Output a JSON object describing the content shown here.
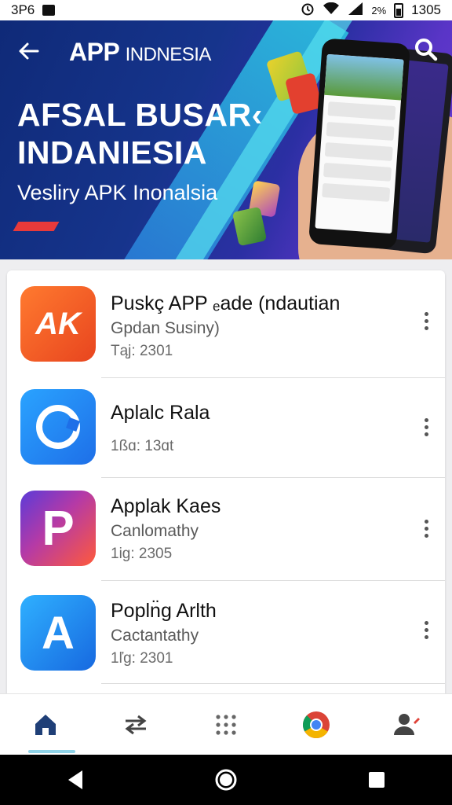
{
  "status_bar": {
    "left_text": "3P6",
    "time": "1305",
    "battery_text": "2%",
    "icons": [
      "notification-icon",
      "alarm-icon",
      "wifi-icon",
      "signal-icon",
      "battery-icon"
    ]
  },
  "header": {
    "brand_part1": "APP",
    "brand_part2": "INDNESIA",
    "back_icon": "back-arrow-icon",
    "search_icon": "search-icon"
  },
  "banner": {
    "title_line1": "AFSAL BUSAR‹",
    "title_line2": "INDANIESIA",
    "subtitle": "Vesliry APK Inonalsia",
    "accent_color": "#e83a3a"
  },
  "apps": [
    {
      "name": "Puskç APP ₑade (ndautian",
      "subtitle": "Gpdan Susiny)",
      "meta": "Tąj: 2301",
      "icon_label": "AK",
      "icon": "ak-app-icon"
    },
    {
      "name": "Aplalc Rala",
      "subtitle": "",
      "meta": "1ßɑ: 13ɑt",
      "icon_label": "",
      "icon": "c-ring-app-icon"
    },
    {
      "name": "Applak Kaes",
      "subtitle": "Canlomathy",
      "meta": "1ig: 2305",
      "icon_label": "P",
      "icon": "p-app-icon"
    },
    {
      "name": "Popln̈g Arlth",
      "subtitle": "Cactantathy",
      "meta": "1ľg: 2301",
      "icon_label": "A",
      "icon": "a-app-icon"
    }
  ],
  "bottom_nav": [
    {
      "icon": "home-icon",
      "active": true
    },
    {
      "icon": "swap-arrows-icon",
      "active": false
    },
    {
      "icon": "grid-apps-icon",
      "active": false
    },
    {
      "icon": "chrome-icon",
      "active": false
    },
    {
      "icon": "profile-edit-icon",
      "active": false
    }
  ],
  "system_nav": [
    "back-triangle-icon",
    "home-circle-icon",
    "recents-square-icon"
  ]
}
